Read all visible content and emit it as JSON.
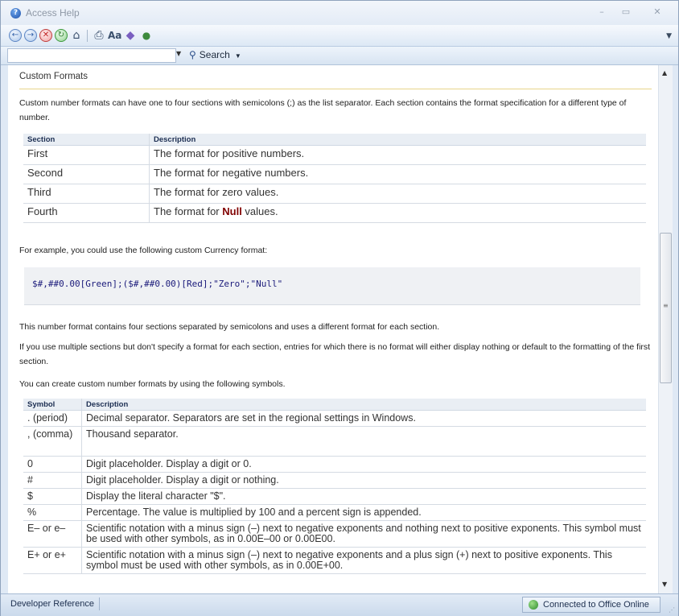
{
  "window": {
    "title": "Access Help",
    "minimize": "–",
    "maximize": "▭",
    "close": "✕"
  },
  "search": {
    "placeholder": "",
    "button_label": "Search"
  },
  "content": {
    "page_title": "Custom Formats",
    "intro": "Custom number formats can have one to four sections with semicolons (;) as the list separator. Each section contains the format specification for a different type of number.",
    "sections_table": {
      "headers": [
        "Section",
        "Description"
      ],
      "rows": [
        {
          "section": "First",
          "desc": "The format for positive numbers."
        },
        {
          "section": "Second",
          "desc": "The format for negative numbers."
        },
        {
          "section": "Third",
          "desc": "The format for zero values."
        },
        {
          "section": "Fourth",
          "desc_before": "The format for ",
          "desc_bold": "Null",
          "desc_after": " values."
        }
      ]
    },
    "example_intro": "For example, you could use the following custom Currency format:",
    "example_code": "$#,##0.00[Green];($#,##0.00)[Red];\"Zero\";\"Null\"",
    "para_sections": "This number format contains four sections separated by semicolons and uses a different format for each section.",
    "para_multiple": "If you use multiple sections but don't specify a format for each section, entries for which there is no format will either display nothing or default to the formatting of the first section.",
    "para_symbols": "You can create custom number formats by using the following symbols.",
    "symbols_table": {
      "headers": [
        "Symbol",
        "Description"
      ],
      "rows": [
        {
          "symbol": ". (period)",
          "desc": "Decimal separator. Separators are set in the regional settings in Windows."
        },
        {
          "symbol": ", (comma)",
          "desc": "Thousand separator."
        },
        {
          "symbol": "0",
          "desc": "Digit placeholder. Display a digit or 0."
        },
        {
          "symbol": "#",
          "desc": "Digit placeholder. Display a digit or nothing."
        },
        {
          "symbol": "$",
          "desc": "Display the literal character \"$\"."
        },
        {
          "symbol": "%",
          "desc": "Percentage. The value is multiplied by 100 and a percent sign is appended."
        },
        {
          "symbol": "E– or e–",
          "desc": "Scientific notation with a minus sign (–) next to negative exponents and nothing next to positive exponents. This symbol must be used with other symbols, as in 0.00E–00 or 0.00E00."
        },
        {
          "symbol": "E+ or e+",
          "desc": "Scientific notation with a minus sign (–) next to negative exponents and a plus sign (+) next to positive exponents. This symbol must be used with other symbols, as in 0.00E+00."
        }
      ]
    }
  },
  "statusbar": {
    "left": "Developer Reference",
    "connection": "Connected to Office Online"
  }
}
